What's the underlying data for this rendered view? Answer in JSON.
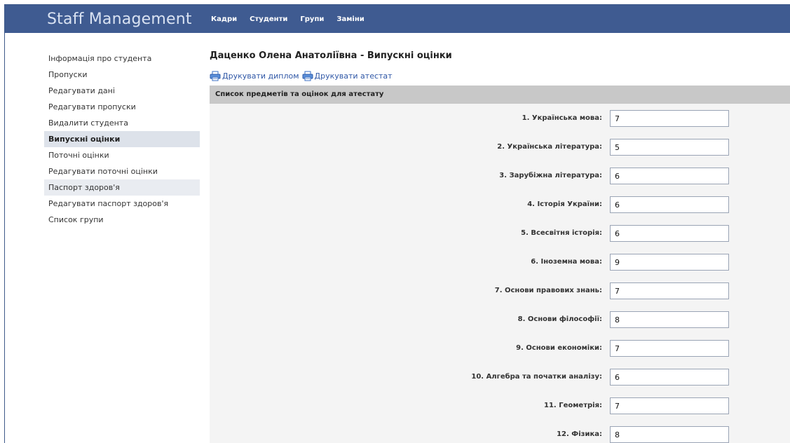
{
  "app": {
    "title": "Staff Management"
  },
  "nav": [
    "Кадри",
    "Студенти",
    "Групи",
    "Заміни"
  ],
  "sidebar": {
    "items": [
      {
        "label": "Інформація про студента",
        "state": ""
      },
      {
        "label": "Пропуски",
        "state": ""
      },
      {
        "label": "Редагувати дані",
        "state": ""
      },
      {
        "label": "Редагувати пропуски",
        "state": ""
      },
      {
        "label": "Видалити студента",
        "state": ""
      },
      {
        "label": "Випускні оцінки",
        "state": "active"
      },
      {
        "label": "Поточні оцінки",
        "state": ""
      },
      {
        "label": "Редагувати поточні оцінки",
        "state": ""
      },
      {
        "label": "Паспорт здоров'я",
        "state": "hover"
      },
      {
        "label": "Редагувати паспорт здоров'я",
        "state": ""
      },
      {
        "label": "Список групи",
        "state": ""
      }
    ]
  },
  "main": {
    "title": "Даценко Олена Анатоліївна - Випускні оцінки",
    "actions": {
      "print_diploma": "Друкувати диплом",
      "print_certificate": "Друкувати атестат"
    },
    "section_title": "Список предметів та оцінок для атестату",
    "grades": [
      {
        "label": "1. Українська мова:",
        "value": "7"
      },
      {
        "label": "2. Українська література:",
        "value": "5"
      },
      {
        "label": "3. Зарубіжна література:",
        "value": "6"
      },
      {
        "label": "4. Історія України:",
        "value": "6"
      },
      {
        "label": "5. Всесвітня історія:",
        "value": "6"
      },
      {
        "label": "6. Іноземна мова:",
        "value": "9"
      },
      {
        "label": "7. Основи правових знань:",
        "value": "7"
      },
      {
        "label": "8. Основи філософії:",
        "value": "8"
      },
      {
        "label": "9. Основи економіки:",
        "value": "7"
      },
      {
        "label": "10. Алгебра та початки аналізу:",
        "value": "6"
      },
      {
        "label": "11. Геометрія:",
        "value": "7"
      },
      {
        "label": "12. Фізика:",
        "value": "8"
      }
    ]
  },
  "colors": {
    "header_bg": "#3f5b91",
    "link": "#2f57a6",
    "section_bg": "#c8c8c8",
    "active_item_bg": "#dde2ea"
  },
  "icons": {
    "print": "printer-icon"
  }
}
